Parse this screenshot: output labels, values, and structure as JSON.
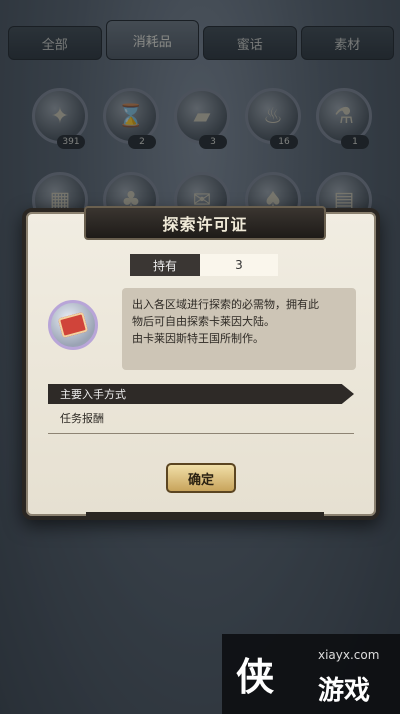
{
  "tabs": [
    {
      "label": "全部"
    },
    {
      "label": "消耗品"
    },
    {
      "label": "蜜话"
    },
    {
      "label": "素材"
    }
  ],
  "items": [
    {
      "count": "391",
      "icon": "coin-pouch-icon"
    },
    {
      "count": "2",
      "icon": "scroll-icon"
    },
    {
      "count": "3",
      "icon": "license-card-icon"
    },
    {
      "count": "16",
      "icon": "potion-icon"
    },
    {
      "count": "1",
      "icon": "flask-icon"
    },
    {
      "count": "",
      "icon": "map-icon"
    },
    {
      "count": "",
      "icon": "bottle-icon"
    },
    {
      "count": "",
      "icon": "letter-icon"
    },
    {
      "count": "",
      "icon": "vial-icon"
    },
    {
      "count": "",
      "icon": "ticket-icon"
    }
  ],
  "dialog": {
    "title": "探索许可证",
    "hold_label": "持有",
    "hold_value": "3",
    "description_line1": "出入各区域进行探索的必需物，拥有此",
    "description_line2": "物后可自由探索卡莱因大陆。",
    "description_line3": "由卡莱因斯特王国所制作。",
    "source_header": "主要入手方式",
    "source_text": "任务报酬",
    "confirm_label": "确定"
  },
  "watermark": {
    "logo": "侠",
    "site": "xiayx.com",
    "name": "游戏"
  }
}
